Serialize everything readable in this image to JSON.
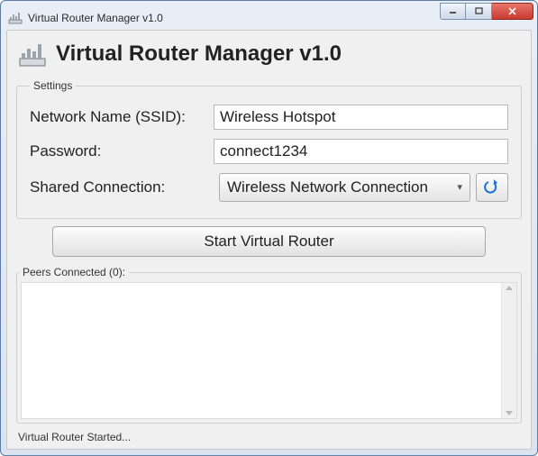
{
  "window": {
    "title": "Virtual Router Manager v1.0"
  },
  "app": {
    "title": "Virtual Router Manager v1.0"
  },
  "settings": {
    "legend": "Settings",
    "ssid_label": "Network Name (SSID):",
    "ssid_value": "Wireless Hotspot",
    "password_label": "Password:",
    "password_value": "connect1234",
    "shared_label": "Shared Connection:",
    "shared_selected": "Wireless Network Connection"
  },
  "start_button": {
    "label": "Start Virtual Router"
  },
  "peers": {
    "legend": "Peers Connected (0):",
    "count": 0
  },
  "status": {
    "text": "Virtual Router Started..."
  }
}
